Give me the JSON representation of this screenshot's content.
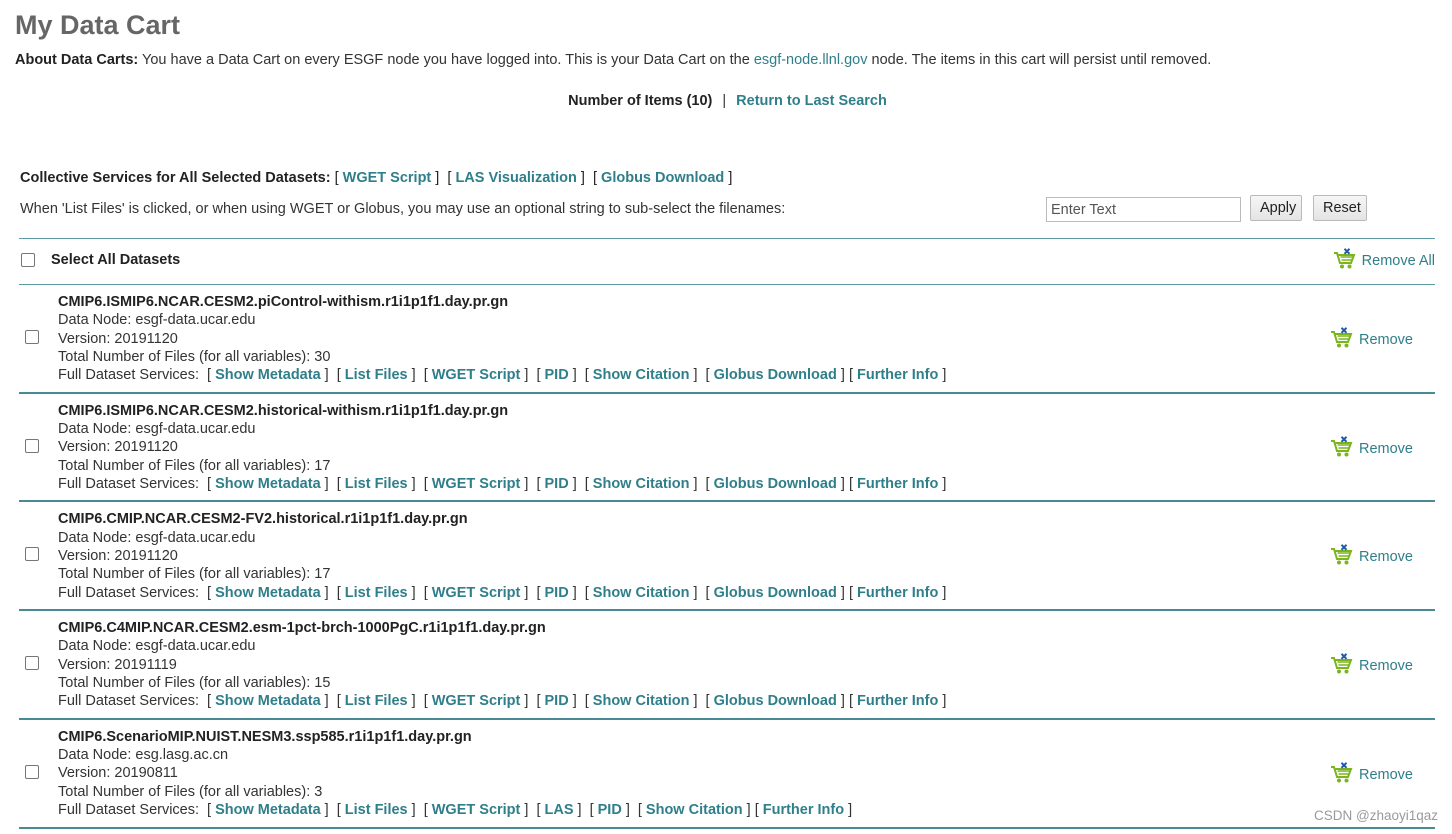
{
  "page": {
    "title": "My Data Cart"
  },
  "about": {
    "label": "About Data Carts:",
    "text_before": " You have a Data Cart on every ESGF node you have logged into. This is your Data Cart on the ",
    "node_link": "esgf-node.llnl.gov",
    "text_after": " node. The items in this cart will persist until removed."
  },
  "items_bar": {
    "count_text": "Number of Items (10)",
    "separator": "|",
    "return_link": "Return to Last Search"
  },
  "collective": {
    "label": "Collective Services for All Selected Datasets:",
    "wget": "WGET Script",
    "las": "LAS Visualization",
    "globus": "Globus Download"
  },
  "filter": {
    "note": "When 'List Files' is clicked, or when using WGET or Globus, you may use an optional string to sub-select the filenames:",
    "placeholder": "Enter Text",
    "value": "",
    "apply": "Apply",
    "reset": "Reset"
  },
  "select_all": {
    "label": "Select All Datasets",
    "remove_all": "Remove All"
  },
  "dataset_labels": {
    "remove": "Remove",
    "services_label": "Full Dataset Services:",
    "open_bracket": "[",
    "close_bracket": "]",
    "svc_show_metadata": "Show Metadata",
    "svc_list_files": "List Files",
    "svc_wget": "WGET Script",
    "svc_pid": "PID",
    "svc_las": "LAS",
    "svc_show_citation": "Show Citation",
    "svc_globus": "Globus Download",
    "svc_further_info": "Further Info"
  },
  "datasets": [
    {
      "id": "CMIP6.ISMIP6.NCAR.CESM2.piControl-withism.r1i1p1f1.day.pr.gn",
      "data_node": "Data Node: esgf-data.ucar.edu",
      "version": "Version: 20191120",
      "files": "Total Number of Files (for all variables): 30",
      "checked": false
    },
    {
      "id": "CMIP6.ISMIP6.NCAR.CESM2.historical-withism.r1i1p1f1.day.pr.gn",
      "data_node": "Data Node: esgf-data.ucar.edu",
      "version": "Version: 20191120",
      "files": "Total Number of Files (for all variables): 17",
      "checked": false
    },
    {
      "id": "CMIP6.CMIP.NCAR.CESM2-FV2.historical.r1i1p1f1.day.pr.gn",
      "data_node": "Data Node: esgf-data.ucar.edu",
      "version": "Version: 20191120",
      "files": "Total Number of Files (for all variables): 17",
      "checked": false
    },
    {
      "id": "CMIP6.C4MIP.NCAR.CESM2.esm-1pct-brch-1000PgC.r1i1p1f1.day.pr.gn",
      "data_node": "Data Node: esgf-data.ucar.edu",
      "version": "Version: 20191119",
      "files": "Total Number of Files (for all variables): 15",
      "checked": false
    },
    {
      "id": "CMIP6.ScenarioMIP.NUIST.NESM3.ssp585.r1i1p1f1.day.pr.gn",
      "data_node": "Data Node: esg.lasg.ac.cn",
      "version": "Version: 20190811",
      "files": "Total Number of Files (for all variables): 3",
      "checked": false
    }
  ],
  "watermark": "CSDN @zhaoyi1qaz",
  "colors": {
    "link": "#2f7f8a",
    "divider": "#4a8a95",
    "title": "#666666",
    "cart_green": "#7ab51d",
    "cart_x_blue": "#1e5aa8"
  },
  "icons": {
    "remove": "cart-remove-icon"
  }
}
